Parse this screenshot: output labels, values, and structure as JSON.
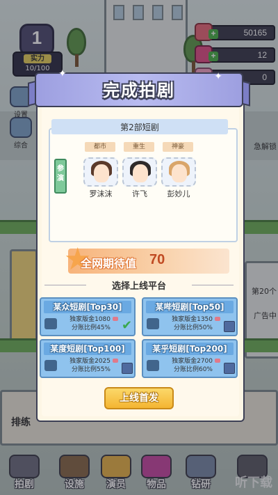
{
  "hud": {
    "level": "1",
    "power_label": "实力",
    "power_value": "10/100",
    "resources": [
      {
        "icon": "cash-icon",
        "value": "50165"
      },
      {
        "icon": "gem-icon",
        "value": "12"
      },
      {
        "icon": "ticket-icon",
        "value": "0"
      }
    ]
  },
  "side_buttons": [
    {
      "label": "设置"
    },
    {
      "label": "综合"
    }
  ],
  "right_texts": [
    "急解锁",
    "第20个",
    "广告中"
  ],
  "bottom_nav": [
    {
      "label": "拍剧"
    },
    {
      "label": "设施"
    },
    {
      "label": "演员"
    },
    {
      "label": "物品"
    },
    {
      "label": "钻研"
    }
  ],
  "bottom_left_label": "排练",
  "watermark": "听下载",
  "dialog": {
    "title": "完成拍剧",
    "drama_title": "第2部短剧",
    "tags": [
      "都市",
      "重生",
      "神豪"
    ],
    "cast_label": "参演",
    "actors": [
      {
        "name": "罗沫沫",
        "hair": "#5b3a2a"
      },
      {
        "name": "许飞",
        "hair": "#2e2a2a"
      },
      {
        "name": "彭妙儿",
        "hair": "#d9a56a"
      }
    ],
    "anticipation_label": "全网期待值",
    "anticipation_value": "70",
    "section_title": "选择上线平台",
    "platforms": [
      {
        "name": "某众短剧[Top30]",
        "fee_label": "独家版金1080",
        "share_label": "分账比例45%",
        "selected": true
      },
      {
        "name": "某哔短剧[Top50]",
        "fee_label": "独家版金1350",
        "share_label": "分账比例50%",
        "selected": false
      },
      {
        "name": "某度短剧[Top100]",
        "fee_label": "独家版金2025",
        "share_label": "分账比例55%",
        "selected": false
      },
      {
        "name": "某乎短剧[Top200]",
        "fee_label": "独家版金2700",
        "share_label": "分账比例60%",
        "selected": false
      }
    ],
    "confirm_button": "上线首发"
  }
}
